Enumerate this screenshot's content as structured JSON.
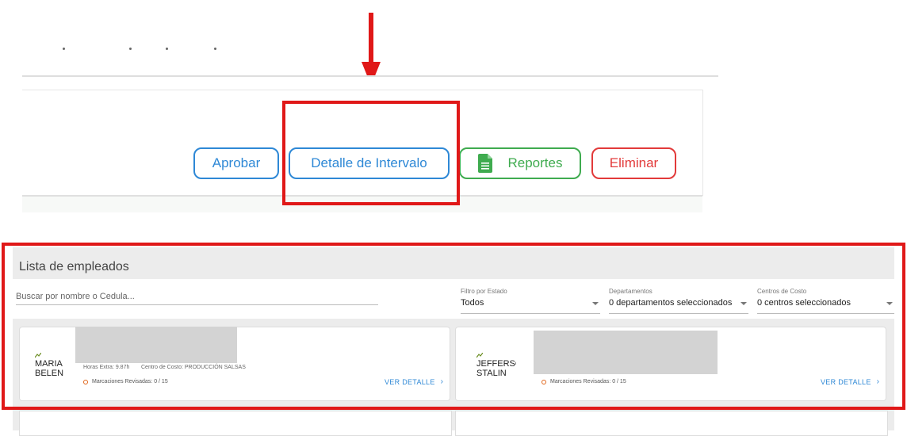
{
  "toolbar": {
    "aprobar_label": "Aprobar",
    "detalle_label": "Detalle de Intervalo",
    "reportes_label": "Reportes",
    "eliminar_label": "Eliminar"
  },
  "employees_panel": {
    "title": "Lista de empleados",
    "search_placeholder": "Buscar por nombre o Cedula...",
    "filters": [
      {
        "label": "Filtro por Estado",
        "value": "Todos"
      },
      {
        "label": "Departamentos",
        "value": "0 departamentos seleccionados"
      },
      {
        "label": "Centros de Costo",
        "value": "0 centros seleccionados"
      }
    ],
    "employees": [
      {
        "avatar_alt": "MARIA\nBELEN",
        "horas_extra": "Horas Extra: 9.87h",
        "centro_costo": "Centro de Costo: PRODUCCIÓN SALSAS",
        "marcaciones": "Marcaciones Revisadas: 0 / 15",
        "ver_detalle": "VER DETALLE"
      },
      {
        "avatar_alt": "JEFFERSON\nSTALIN",
        "marcaciones": "Marcaciones Revisadas: 0 / 15",
        "ver_detalle": "VER DETALLE"
      }
    ]
  },
  "colors": {
    "annotation_red": "#e01818",
    "primary_blue": "#2e88d6",
    "success_green": "#3fab4f",
    "danger_red": "#e23a3a"
  },
  "icons": [
    "arrow-down-icon",
    "spreadsheet-icon",
    "chevron-right-icon",
    "caret-down-icon",
    "status-ring-icon",
    "broken-image-icon"
  ]
}
